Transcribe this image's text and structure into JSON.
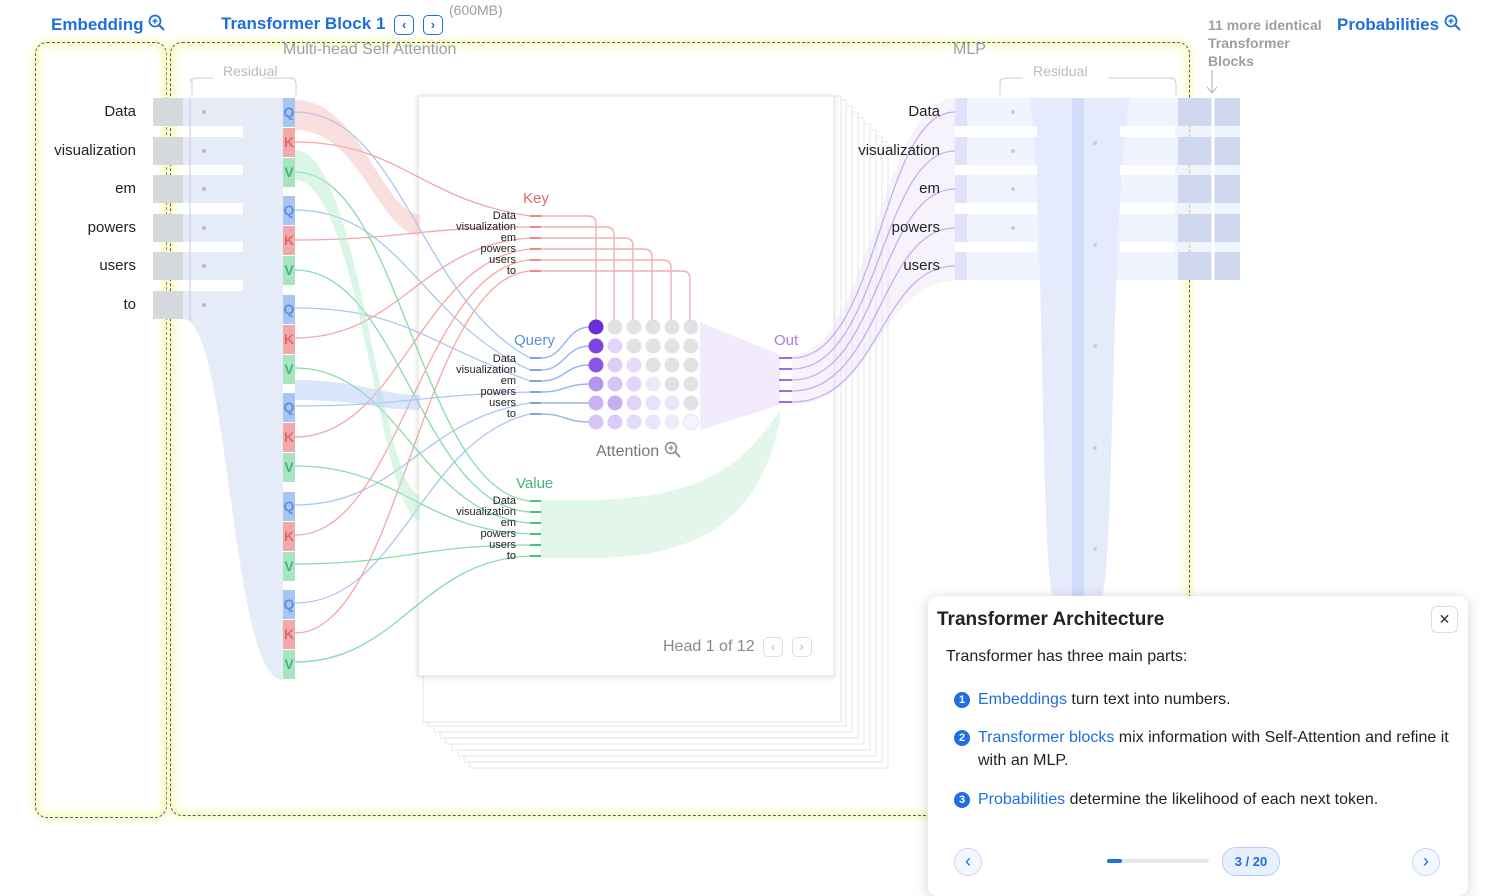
{
  "header": {
    "embedding_label": "Embedding",
    "block_label": "Transformer Block 1",
    "size_note": "(600MB)",
    "more_blocks": "more identical Transformer Blocks",
    "more_count": "11",
    "probabilities_label": "Probabilities",
    "prev_glyph": "‹",
    "next_glyph": "›"
  },
  "sections": {
    "mhsa": "Multi-head Self Attention",
    "mlp": "MLP",
    "residual_left": "Residual",
    "residual_right": "Residual"
  },
  "tokens": [
    "Data",
    "visualization",
    "em",
    "powers",
    "users",
    "to"
  ],
  "mlp_tokens": [
    "Data",
    "visualization",
    "em",
    "powers",
    "users"
  ],
  "qkv_letters": [
    "Q",
    "K",
    "V"
  ],
  "attention": {
    "key_label": "Key",
    "query_label": "Query",
    "value_label": "Value",
    "out_label": "Out",
    "attention_label": "Attention",
    "head_label": "Head 1 of 12"
  },
  "tutorial": {
    "title": "Transformer Architecture",
    "intro": "Transformer has three main parts:",
    "items": [
      {
        "num": "1",
        "link": "Embeddings",
        "text": " turn text into numbers."
      },
      {
        "num": "2",
        "link": "Transformer blocks",
        "text": " mix information with Self-Attention and refine it with an MLP."
      },
      {
        "num": "3",
        "link": "Probabilities",
        "text": " determine the likelihood of each next token."
      }
    ],
    "page": "3 / 20",
    "progress": 0.15,
    "close_glyph": "✕"
  },
  "colors": {
    "accent": "#1f6fe0",
    "query": "#5b8fe0",
    "key": "#e06a6a",
    "value": "#3fb878",
    "out": "#a57be8"
  }
}
